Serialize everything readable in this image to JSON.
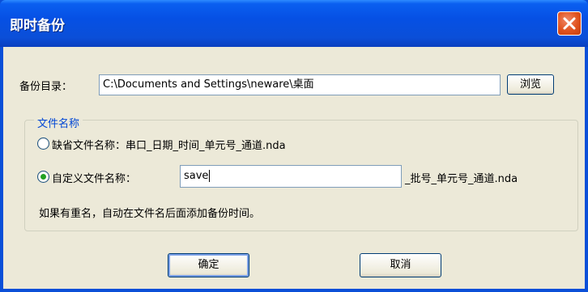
{
  "window": {
    "title": "即时备份",
    "close_icon": "close-icon"
  },
  "backup_dir": {
    "label": "备份目录：",
    "value": "C:\\Documents and Settings\\neware\\桌面",
    "browse_label": "浏览"
  },
  "file_name_group": {
    "title": "文件名称",
    "default_option": {
      "label": "缺省文件名称：串口_日期_时间_单元号_通道.nda",
      "checked": false
    },
    "custom_option": {
      "label": "自定义文件名称：",
      "checked": true,
      "input_value": "save",
      "suffix": "_批号_单元号_通道.nda"
    },
    "note": "如果有重名，自动在文件名后面添加备份时间。"
  },
  "buttons": {
    "ok_label": "确定",
    "cancel_label": "取消"
  },
  "colors": {
    "titlebar": "#0650e4",
    "close": "#e0521e",
    "face": "#ece9d8",
    "group_title": "#0046d5"
  }
}
